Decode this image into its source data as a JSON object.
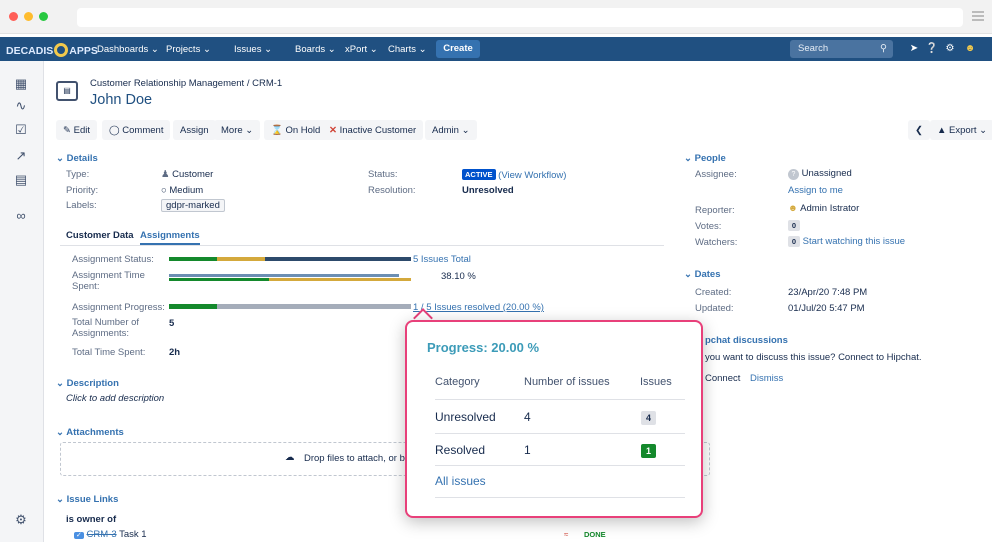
{
  "topnav": {
    "logo": "DECADIS",
    "logo_suffix": "APPS",
    "items": [
      "Dashboards ⌄",
      "Projects ⌄",
      "Issues ⌄",
      "Boards ⌄",
      "xPort ⌄",
      "Charts ⌄"
    ],
    "create": "Create",
    "search_placeholder": "Search"
  },
  "issue": {
    "breadcrumb": "Customer Relationship Management / CRM-1",
    "title": "John Doe"
  },
  "toolbar": {
    "edit": "Edit",
    "comment": "Comment",
    "assign": "Assign",
    "more": "More ⌄",
    "on_hold": "On Hold",
    "inactive": "Inactive Customer",
    "admin": "Admin ⌄",
    "export": "Export ⌄"
  },
  "details": {
    "heading": "Details",
    "type_label": "Type:",
    "type_value": "Customer",
    "priority_label": "Priority:",
    "priority_value": "Medium",
    "labels_label": "Labels:",
    "labels_value": "gdpr-marked",
    "status_label": "Status:",
    "status_value": "ACTIVE",
    "status_link": "(View Workflow)",
    "resolution_label": "Resolution:",
    "resolution_value": "Unresolved"
  },
  "tabs": [
    "Customer Data",
    "Assignments"
  ],
  "assignments": {
    "status_label": "Assignment Status:",
    "status_text": "5 Issues Total",
    "time_label": "Assignment Time Spent:",
    "time_text": "38.10 %",
    "progress_label": "Assignment Progress:",
    "progress_text": "1 / 5 Issues resolved (20.00 %)",
    "total_label": "Total Number of Assignments:",
    "total_value": "5",
    "time_spent_label": "Total Time Spent:",
    "time_spent_value": "2h",
    "time_spent_fraction": 0.381,
    "progress_fraction": 0.2
  },
  "description": {
    "heading": "Description",
    "placeholder": "Click to add description"
  },
  "attachments": {
    "heading": "Attachments",
    "drop_text": "Drop files to attach, or br"
  },
  "issue_links": {
    "heading": "Issue Links",
    "relation": "is owner of",
    "key": "CRM-3",
    "summary": "Task 1",
    "status": "DONE"
  },
  "people": {
    "heading": "People",
    "assignee_label": "Assignee:",
    "assignee_value": "Unassigned",
    "assign_me": "Assign to me",
    "reporter_label": "Reporter:",
    "reporter_value": "Admin Istrator",
    "votes_label": "Votes:",
    "votes_value": "0",
    "watchers_label": "Watchers:",
    "watchers_value": "0",
    "watch_link": "Start watching this issue"
  },
  "dates": {
    "heading": "Dates",
    "created_label": "Created:",
    "created_value": "23/Apr/20 7:48 PM",
    "updated_label": "Updated:",
    "updated_value": "01/Jul/20 5:47 PM"
  },
  "hipchat": {
    "heading": "pchat discussions",
    "text": "you want to discuss this issue? Connect to Hipchat.",
    "connect": "Connect",
    "dismiss": "Dismiss"
  },
  "popup": {
    "title": "Progress: 20.00 %",
    "col_category": "Category",
    "col_number": "Number of issues",
    "col_issues": "Issues",
    "rows": [
      {
        "category": "Unresolved",
        "number": "4",
        "badge": "4"
      },
      {
        "category": "Resolved",
        "number": "1",
        "badge": "1"
      }
    ],
    "all_issues": "All issues"
  },
  "colors": {
    "nav": "#205081",
    "accent": "#3572b0",
    "popup_border": "#e8407a",
    "bar_green": "#14892c",
    "bar_yellow": "#d4a93c",
    "bar_blue": "#2d4a6b"
  }
}
